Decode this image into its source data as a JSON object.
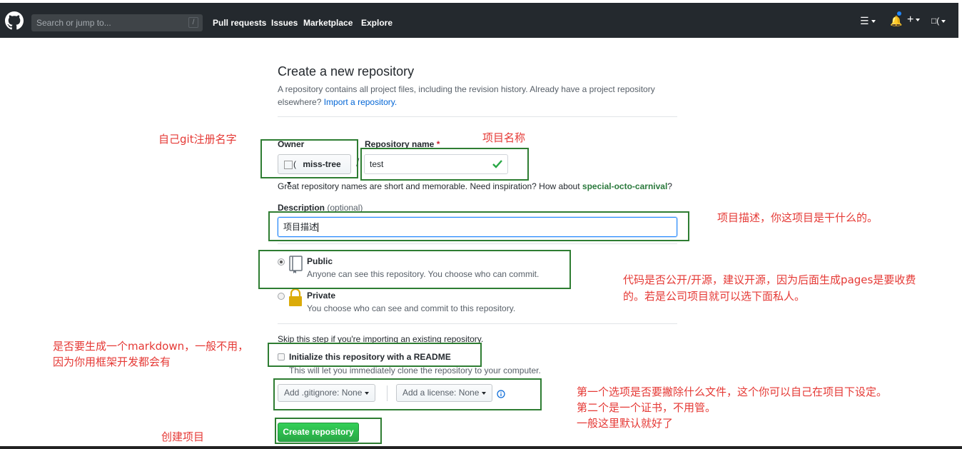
{
  "header": {
    "search_placeholder": "Search or jump to...",
    "search_shortcut": "/",
    "nav": [
      "Pull requests",
      "Issues",
      "Marketplace",
      "Explore"
    ]
  },
  "page": {
    "title": "Create a new repository",
    "subtitle": "A repository contains all project files, including the revision history. Already have a project repository elsewhere?",
    "import_link": "Import a repository.",
    "owner_label": "Owner",
    "owner_value": "miss-tree",
    "owner_avatar_alt": "(",
    "slash": "/",
    "repo_label": "Repository name",
    "required_mark": "*",
    "repo_value": "test",
    "hint_prefix": "Great repository names are short and memorable. Need inspiration? How about",
    "hint_suggestion": "special-octo-carnival",
    "hint_suffix": "?",
    "desc_label": "Description",
    "desc_optional": "(optional)",
    "desc_value": "项目描述",
    "public_label": "Public",
    "public_desc": "Anyone can see this repository. You choose who can commit.",
    "private_label": "Private",
    "private_desc": "You choose who can see and commit to this repository.",
    "skip_text": "Skip this step if you're importing an existing repository.",
    "readme_label": "Initialize this repository with a README",
    "readme_desc": "This will let you immediately clone the repository to your computer.",
    "gitignore_btn": "Add .gitignore: None",
    "license_btn": "Add a license: None",
    "create_btn": "Create repository"
  },
  "annotations": {
    "owner_note": "自己git注册名字",
    "repo_note": "项目名称",
    "desc_note": "项目描述，你这项目是干什么的。",
    "visibility_note_1": "代码是否公开/开源，建议开源，因为后面生成pages是要收费",
    "visibility_note_2": "的。若是公司项目就可以选下面私人。",
    "readme_note_1": "是否要生成一个markdown，一般不用，",
    "readme_note_2": "因为你用框架开发都会有",
    "options_note_1": "第一个选项是否要撇除什么文件，这个你可以自己在项目下设定。",
    "options_note_2": "第二个是一个证书，不用管。",
    "options_note_3": "一般这里默认就好了",
    "create_note": "创建项目"
  },
  "colors": {
    "header_bg": "#24292e",
    "annotation_red": "#e53935",
    "annotation_box": "#2e7d32",
    "primary_green": "#28a745",
    "link_blue": "#0366d6"
  }
}
